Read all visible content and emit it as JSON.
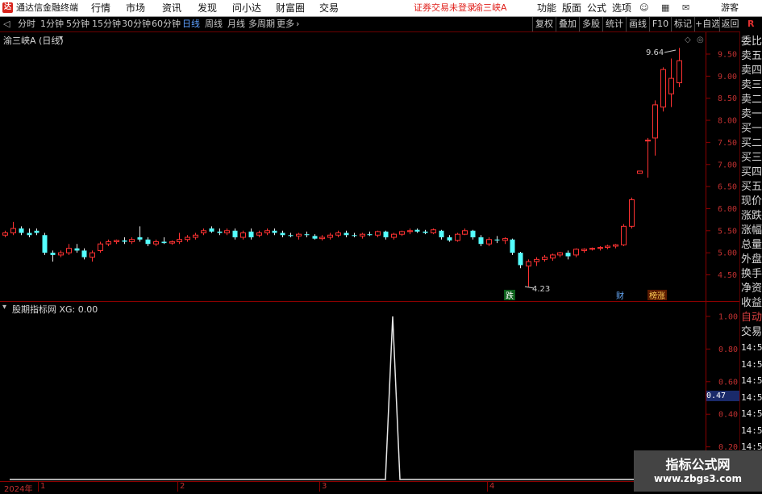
{
  "titlebar": {
    "app_name": "通达信金融终端",
    "menus": [
      "行情",
      "市场",
      "资讯",
      "发现",
      "问小达",
      "财富圈",
      "交易"
    ],
    "notice": "证券交易未登录",
    "stock_name": "渝三峡A",
    "right_menus": [
      "功能",
      "版面",
      "公式",
      "选项"
    ],
    "guest": "游客"
  },
  "periods": {
    "items": [
      "分时",
      "1分钟",
      "5分钟",
      "15分钟",
      "30分钟",
      "60分钟",
      "日线",
      "周线",
      "月线",
      "多周期",
      "更多"
    ],
    "active": "日线"
  },
  "toolbar_right": [
    "复权",
    "叠加",
    "多股",
    "统计",
    "画线",
    "F10",
    "标记",
    "+自选",
    "返回"
  ],
  "main_chart": {
    "label": "渝三峡A (日线)",
    "high_label": "9.64",
    "low_label": "4.23",
    "markers": [
      "跌",
      "财",
      "榜涨"
    ],
    "y_ticks": [
      "9.50",
      "9.00",
      "8.50",
      "8.00",
      "7.50",
      "7.00",
      "6.50",
      "6.00",
      "5.50",
      "5.00",
      "4.50"
    ]
  },
  "indicator": {
    "label": "股期指标网 XG: 0.00",
    "y_ticks": [
      "1.00",
      "0.80",
      "0.60",
      "0.40",
      "0.20"
    ],
    "current_value": "0.47"
  },
  "x_axis": {
    "year": "2024年",
    "months": [
      "1",
      "2",
      "3",
      "4"
    ]
  },
  "sidebar": {
    "r_label": "R",
    "items": [
      "委比",
      "卖五",
      "卖四",
      "卖三",
      "卖二",
      "卖一",
      "买一",
      "买二",
      "买三",
      "买四",
      "买五",
      "现价",
      "涨跌",
      "涨幅",
      "总量",
      "外盘",
      "换手",
      "净资",
      "收益"
    ],
    "trade_items": [
      "自动",
      "交易"
    ],
    "times": [
      "14:56",
      "14:56",
      "14:56",
      "14:56",
      "14:56",
      "14:56",
      "14:56",
      "14:56"
    ]
  },
  "watermark": {
    "title": "指标公式网",
    "url": "www.zbgs3.com"
  },
  "chart_data": {
    "type": "candlestick",
    "ylim": [
      4.2,
      9.8
    ],
    "candles": [
      [
        5.4,
        5.5,
        5.35,
        5.45
      ],
      [
        5.45,
        5.7,
        5.4,
        5.55
      ],
      [
        5.55,
        5.6,
        5.4,
        5.45
      ],
      [
        5.45,
        5.55,
        5.35,
        5.4
      ],
      [
        5.5,
        5.55,
        5.4,
        5.45
      ],
      [
        5.4,
        5.45,
        4.95,
        5.0
      ],
      [
        5.0,
        5.05,
        4.8,
        4.95
      ],
      [
        4.95,
        5.05,
        4.9,
        5.0
      ],
      [
        5.0,
        5.2,
        4.95,
        5.1
      ],
      [
        5.1,
        5.2,
        5.0,
        5.05
      ],
      [
        5.05,
        5.1,
        4.85,
        4.9
      ],
      [
        4.9,
        5.05,
        4.8,
        5.0
      ],
      [
        5.05,
        5.25,
        5.0,
        5.2
      ],
      [
        5.2,
        5.3,
        5.15,
        5.25
      ],
      [
        5.25,
        5.3,
        5.2,
        5.28
      ],
      [
        5.28,
        5.35,
        5.2,
        5.25
      ],
      [
        5.25,
        5.35,
        5.2,
        5.3
      ],
      [
        5.35,
        5.6,
        5.25,
        5.3
      ],
      [
        5.3,
        5.35,
        5.15,
        5.2
      ],
      [
        5.2,
        5.3,
        5.15,
        5.25
      ],
      [
        5.25,
        5.35,
        5.2,
        5.22
      ],
      [
        5.22,
        5.28,
        5.18,
        5.25
      ],
      [
        5.25,
        5.45,
        5.2,
        5.3
      ],
      [
        5.3,
        5.4,
        5.25,
        5.35
      ],
      [
        5.35,
        5.45,
        5.3,
        5.4
      ],
      [
        5.45,
        5.55,
        5.4,
        5.5
      ],
      [
        5.55,
        5.6,
        5.45,
        5.48
      ],
      [
        5.48,
        5.55,
        5.4,
        5.45
      ],
      [
        5.45,
        5.55,
        5.4,
        5.5
      ],
      [
        5.5,
        5.55,
        5.3,
        5.35
      ],
      [
        5.35,
        5.5,
        5.3,
        5.45
      ],
      [
        5.48,
        5.55,
        5.3,
        5.35
      ],
      [
        5.4,
        5.5,
        5.35,
        5.45
      ],
      [
        5.45,
        5.55,
        5.4,
        5.5
      ],
      [
        5.5,
        5.55,
        5.4,
        5.45
      ],
      [
        5.45,
        5.5,
        5.35,
        5.4
      ],
      [
        5.4,
        5.45,
        5.35,
        5.38
      ],
      [
        5.38,
        5.45,
        5.3,
        5.42
      ],
      [
        5.42,
        5.48,
        5.35,
        5.4
      ],
      [
        5.38,
        5.42,
        5.3,
        5.32
      ],
      [
        5.32,
        5.4,
        5.28,
        5.35
      ],
      [
        5.35,
        5.45,
        5.3,
        5.4
      ],
      [
        5.4,
        5.5,
        5.35,
        5.45
      ],
      [
        5.45,
        5.5,
        5.35,
        5.4
      ],
      [
        5.4,
        5.45,
        5.35,
        5.38
      ],
      [
        5.38,
        5.45,
        5.32,
        5.42
      ],
      [
        5.42,
        5.48,
        5.38,
        5.4
      ],
      [
        5.4,
        5.5,
        5.35,
        5.48
      ],
      [
        5.48,
        5.5,
        5.3,
        5.35
      ],
      [
        5.35,
        5.45,
        5.3,
        5.42
      ],
      [
        5.42,
        5.5,
        5.38,
        5.48
      ],
      [
        5.48,
        5.55,
        5.42,
        5.5
      ],
      [
        5.52,
        5.55,
        5.45,
        5.48
      ],
      [
        5.48,
        5.52,
        5.42,
        5.45
      ],
      [
        5.45,
        5.55,
        5.42,
        5.52
      ],
      [
        5.5,
        5.52,
        5.3,
        5.35
      ],
      [
        5.35,
        5.4,
        5.25,
        5.28
      ],
      [
        5.28,
        5.45,
        5.25,
        5.42
      ],
      [
        5.42,
        5.55,
        5.4,
        5.5
      ],
      [
        5.5,
        5.52,
        5.3,
        5.35
      ],
      [
        5.35,
        5.4,
        5.15,
        5.2
      ],
      [
        5.2,
        5.35,
        5.15,
        5.3
      ],
      [
        5.3,
        5.38,
        5.22,
        5.28
      ],
      [
        5.28,
        5.35,
        5.2,
        5.32
      ],
      [
        5.3,
        5.32,
        4.95,
        5.0
      ],
      [
        5.0,
        5.02,
        4.65,
        4.72
      ],
      [
        4.7,
        4.85,
        4.23,
        4.8
      ],
      [
        4.8,
        4.9,
        4.7,
        4.85
      ],
      [
        4.85,
        4.95,
        4.8,
        4.9
      ],
      [
        4.88,
        4.98,
        4.82,
        4.95
      ],
      [
        4.95,
        5.02,
        4.9,
        5.0
      ],
      [
        5.0,
        5.05,
        4.85,
        4.92
      ],
      [
        4.95,
        5.1,
        4.9,
        5.08
      ],
      [
        5.05,
        5.1,
        5.0,
        5.08
      ],
      [
        5.08,
        5.12,
        5.05,
        5.1
      ],
      [
        5.1,
        5.15,
        5.05,
        5.12
      ],
      [
        5.12,
        5.18,
        5.08,
        5.15
      ],
      [
        5.15,
        5.2,
        5.1,
        5.18
      ],
      [
        5.18,
        5.65,
        5.15,
        5.6
      ],
      [
        5.6,
        6.25,
        5.55,
        6.2
      ],
      [
        6.8,
        6.85,
        6.8,
        6.85
      ],
      [
        7.55,
        7.6,
        6.7,
        7.55
      ],
      [
        7.6,
        8.45,
        7.2,
        8.35
      ],
      [
        8.3,
        9.2,
        8.2,
        9.15
      ],
      [
        8.6,
        9.4,
        8.3,
        8.95
      ],
      [
        8.85,
        9.64,
        8.75,
        9.35
      ]
    ]
  }
}
